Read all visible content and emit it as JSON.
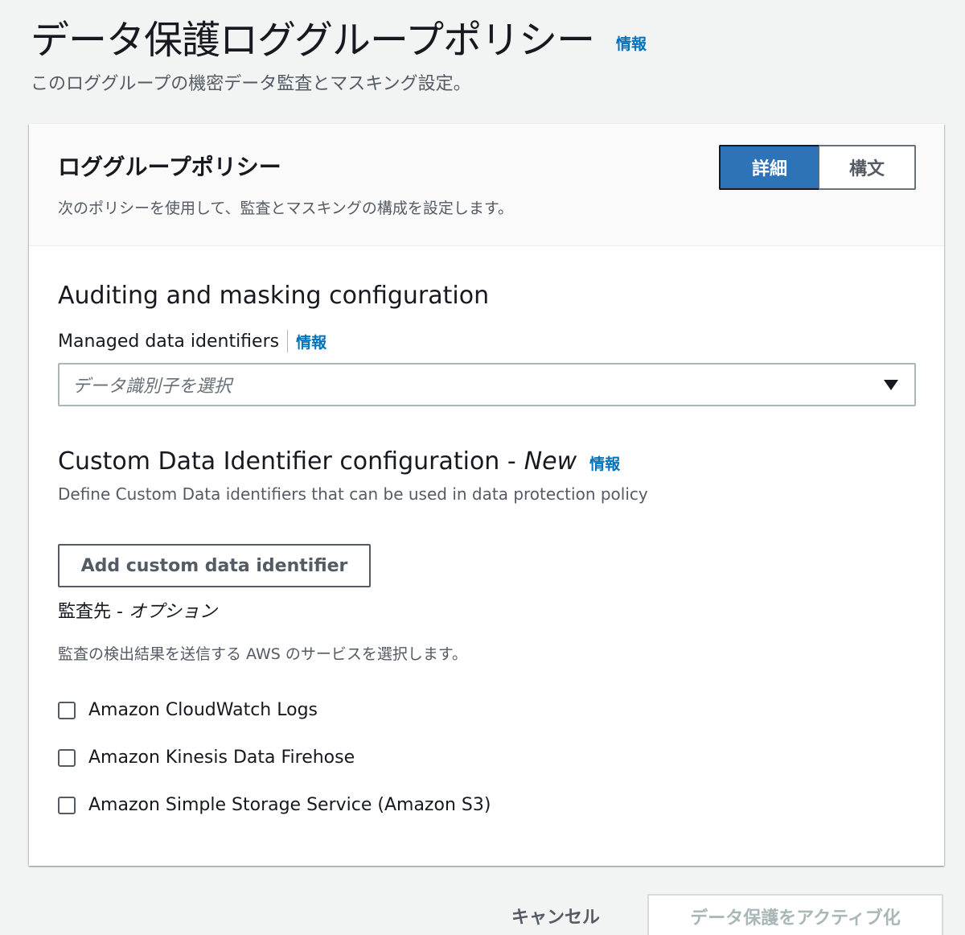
{
  "header": {
    "title": "データ保護ロググループポリシー",
    "info_label": "情報",
    "description": "このロググループの機密データ監査とマスキング設定。"
  },
  "panel": {
    "title": "ロググループポリシー",
    "description": "次のポリシーを使用して、監査とマスキングの構成を設定します。",
    "view_toggle": {
      "options": [
        "詳細",
        "構文"
      ],
      "selected": "詳細"
    }
  },
  "auditing": {
    "section_title": "Auditing and masking configuration",
    "managed_identifiers_label": "Managed data identifiers",
    "info_label": "情報",
    "select_placeholder": "データ識別子を選択"
  },
  "custom_identifiers": {
    "section_title": "Custom Data Identifier configuration -",
    "new_tag": "New",
    "info_label": "情報",
    "description": "Define Custom Data identifiers that can be used in data protection policy",
    "add_button_label": "Add custom data identifier"
  },
  "audit_destination": {
    "label": "監査先 -",
    "optional_label": "オプション",
    "description": "監査の検出結果を送信する AWS のサービスを選択します。",
    "options": [
      {
        "label": "Amazon CloudWatch Logs",
        "checked": false
      },
      {
        "label": "Amazon Kinesis Data Firehose",
        "checked": false
      },
      {
        "label": "Amazon Simple Storage Service (Amazon S3)",
        "checked": false
      }
    ]
  },
  "footer": {
    "cancel_label": "キャンセル",
    "activate_label": "データ保護をアクティブ化"
  },
  "colors": {
    "accent": "#2e73b8",
    "link": "#0073bb",
    "background": "#f2f3f3"
  }
}
